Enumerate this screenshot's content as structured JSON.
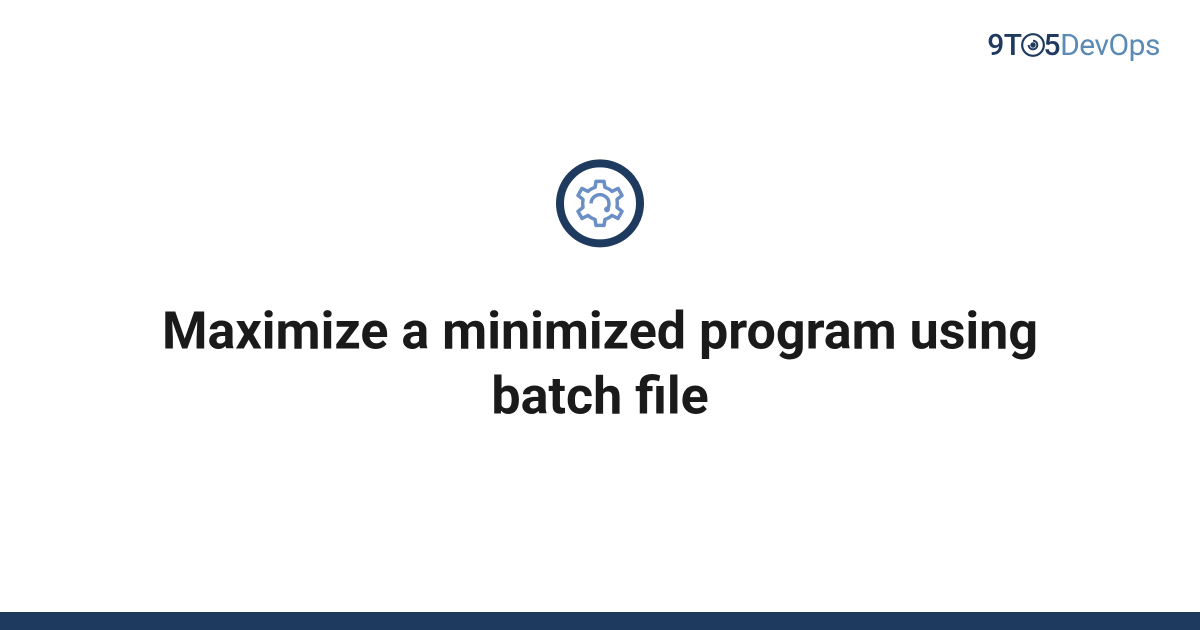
{
  "logo": {
    "part1": "9T",
    "part2": "5",
    "part3": "DevOps"
  },
  "title": "Maximize a minimized program using batch file",
  "colors": {
    "dark_blue": "#1e3a5f",
    "light_blue": "#5b8bb5",
    "gear_blue": "#6b8fc4"
  }
}
